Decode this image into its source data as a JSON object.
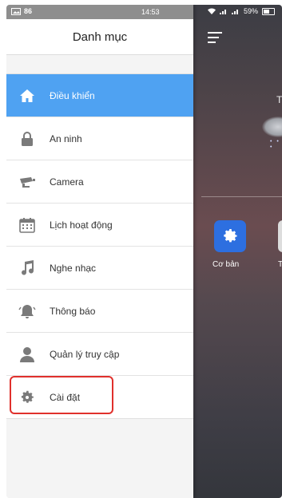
{
  "status_bar": {
    "notification_count": "86",
    "time": "14:53",
    "battery_percent": "59%"
  },
  "drawer": {
    "title": "Danh mục",
    "items": [
      {
        "label": "Điều khiển",
        "icon": "home-icon",
        "active": true
      },
      {
        "label": "An ninh",
        "icon": "lock-icon",
        "active": false
      },
      {
        "label": "Camera",
        "icon": "camera-icon",
        "active": false
      },
      {
        "label": "Lịch hoạt động",
        "icon": "calendar-icon",
        "active": false
      },
      {
        "label": "Nghe nhạc",
        "icon": "music-note-icon",
        "active": false
      },
      {
        "label": "Thông báo",
        "icon": "bell-icon",
        "active": false
      },
      {
        "label": "Quản lý truy cập",
        "icon": "user-icon",
        "active": false
      },
      {
        "label": "Cài đặt",
        "icon": "gear-icon",
        "active": false,
        "highlighted": true
      }
    ]
  },
  "background": {
    "partial_text": "T",
    "tile_label": "Cơ bản",
    "next_tile_partial_label": "T"
  },
  "colors": {
    "active_item": "#4fa2f2",
    "highlight_border": "#e0302c",
    "tile_blue": "#2d6fe0"
  }
}
